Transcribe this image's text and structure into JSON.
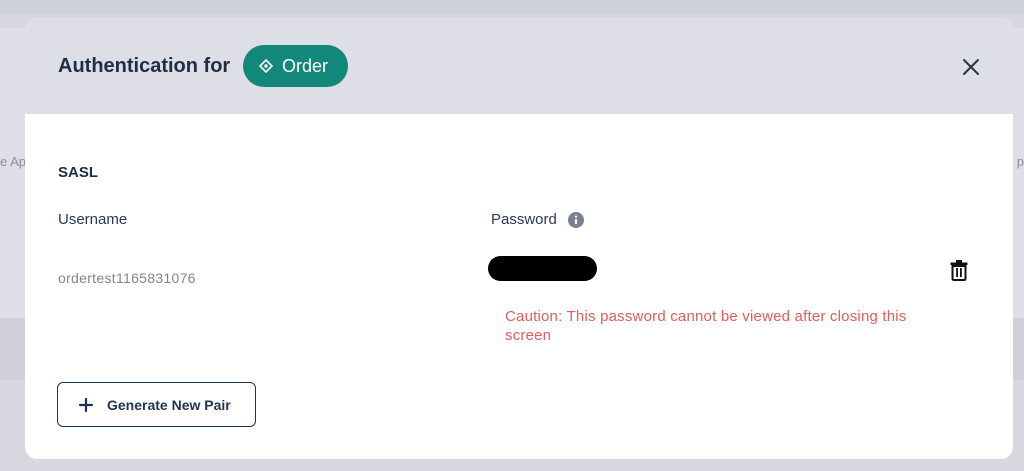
{
  "background": {
    "left_fragment": "e Ap",
    "right_fragment": "p"
  },
  "modal": {
    "title": "Authentication for",
    "entity": {
      "icon": "diamond-icon",
      "label": "Order",
      "color": "#13887a"
    },
    "close_icon": "close-icon"
  },
  "sasl": {
    "section_title": "SASL",
    "columns": {
      "username": "Username",
      "password": "Password"
    },
    "info_icon": "info-icon",
    "username_value": "ordertest1165831076",
    "caution": "Caution: This password cannot be viewed after closing this screen",
    "caution_color": "#e25d5d",
    "delete_icon": "trash-icon"
  },
  "actions": {
    "generate_label": "Generate New Pair",
    "generate_icon": "plus-icon"
  }
}
